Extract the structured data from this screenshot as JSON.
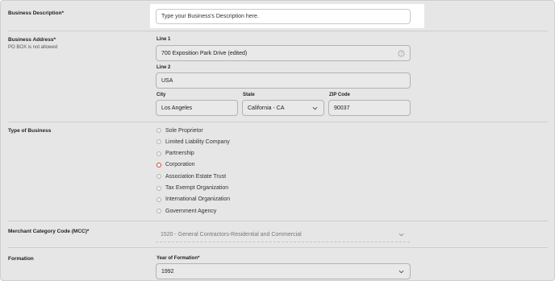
{
  "business_description": {
    "label": "Business Description*",
    "placeholder": "Type your Business's Description here."
  },
  "business_address": {
    "label": "Business Address*",
    "sublabel": "PO BOX is not allowed",
    "line1_label": "Line 1",
    "line1_value": "700 Exposition Park Drive (edited)",
    "line2_label": "Line 2",
    "line2_value": "USA",
    "city_label": "City",
    "city_value": "Los Angeles",
    "state_label": "State",
    "state_value": "California - CA",
    "zip_label": "ZIP Code",
    "zip_value": "90037"
  },
  "type_of_business": {
    "label": "Type of Business",
    "options": [
      {
        "label": "Sole Proprietor",
        "selected": false
      },
      {
        "label": "Limited Liability Company",
        "selected": false
      },
      {
        "label": "Partnership",
        "selected": false
      },
      {
        "label": "Corporation",
        "selected": true
      },
      {
        "label": "Association Estate Trust",
        "selected": false
      },
      {
        "label": "Tax Exempt Organization",
        "selected": false
      },
      {
        "label": "International Organization",
        "selected": false
      },
      {
        "label": "Government Agency",
        "selected": false
      }
    ]
  },
  "mcc": {
    "label": "Merchant Category Code (MCC)*",
    "value": "1520 - General Contractors-Residential and Commercial"
  },
  "formation": {
    "label": "Formation",
    "year_label": "Year of Formation*",
    "year_value": "1992"
  },
  "colors": {
    "background": "#e6e6e6",
    "selected_radio": "#d0432a",
    "divider": "#cdcdcd"
  },
  "icons": {
    "line1_help": "help-circle-icon",
    "state_dropdown": "chevron-down-icon",
    "mcc_dropdown": "chevron-down-icon",
    "year_dropdown": "chevron-down-icon"
  }
}
